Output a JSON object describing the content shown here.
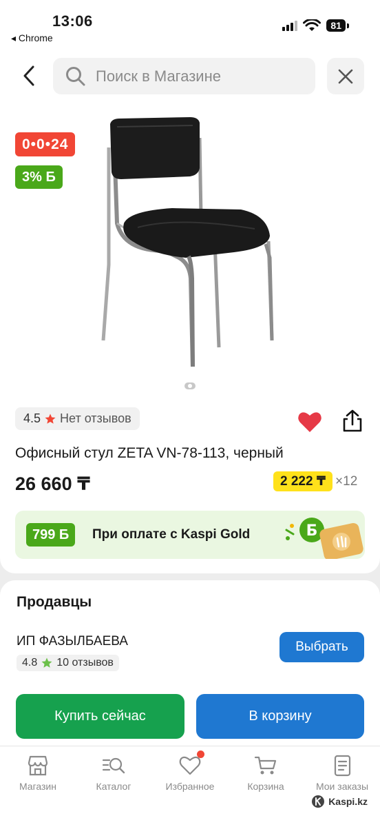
{
  "status_bar": {
    "time": "13:06",
    "back_app": "◂ Chrome",
    "battery": "81",
    "icons": [
      "signal-icon",
      "wifi-icon",
      "battery-icon"
    ]
  },
  "header": {
    "search_placeholder": "Поиск в Магазине",
    "icons": [
      "back-chevron-icon",
      "search-icon",
      "close-icon"
    ]
  },
  "product": {
    "timer_badge": "0•0•24",
    "bonus_badge": "3% Б",
    "rating": "4.5",
    "reviews": "Нет отзывов",
    "title": "Офисный стул ZETA VN-78-113, черный",
    "price": "26 660 ₸",
    "installment_amount": "2 222 ₸",
    "installment_multiplier": "×12",
    "image_icon": "chair-image",
    "carousel_current": 1,
    "carousel_total": 1,
    "favorite_active": true
  },
  "gold_banner": {
    "bonus": "799 Б",
    "text": "При оплате с Kaspi Gold"
  },
  "sellers": {
    "title": "Продавцы",
    "seller_name": "ИП ФАЗЫЛБАЕВА",
    "seller_rating": "4.8",
    "seller_reviews": "10 отзывов",
    "choose_label": "Выбрать",
    "buy_now_label": "Купить сейчас",
    "add_to_cart_label": "В корзину"
  },
  "nav": {
    "items": [
      {
        "label": "Магазин",
        "icon": "shop-icon"
      },
      {
        "label": "Каталог",
        "icon": "catalog-icon"
      },
      {
        "label": "Избранное",
        "icon": "heart-icon"
      },
      {
        "label": "Корзина",
        "icon": "cart-icon"
      },
      {
        "label": "Мои заказы",
        "icon": "orders-icon"
      }
    ]
  },
  "watermark": "Kaspi.kz",
  "colors": {
    "red": "#f14635",
    "green_bonus": "#4aa81a",
    "blue": "#1f78d1",
    "buy_green": "#16a14e",
    "installment_yellow": "#ffe11b"
  }
}
